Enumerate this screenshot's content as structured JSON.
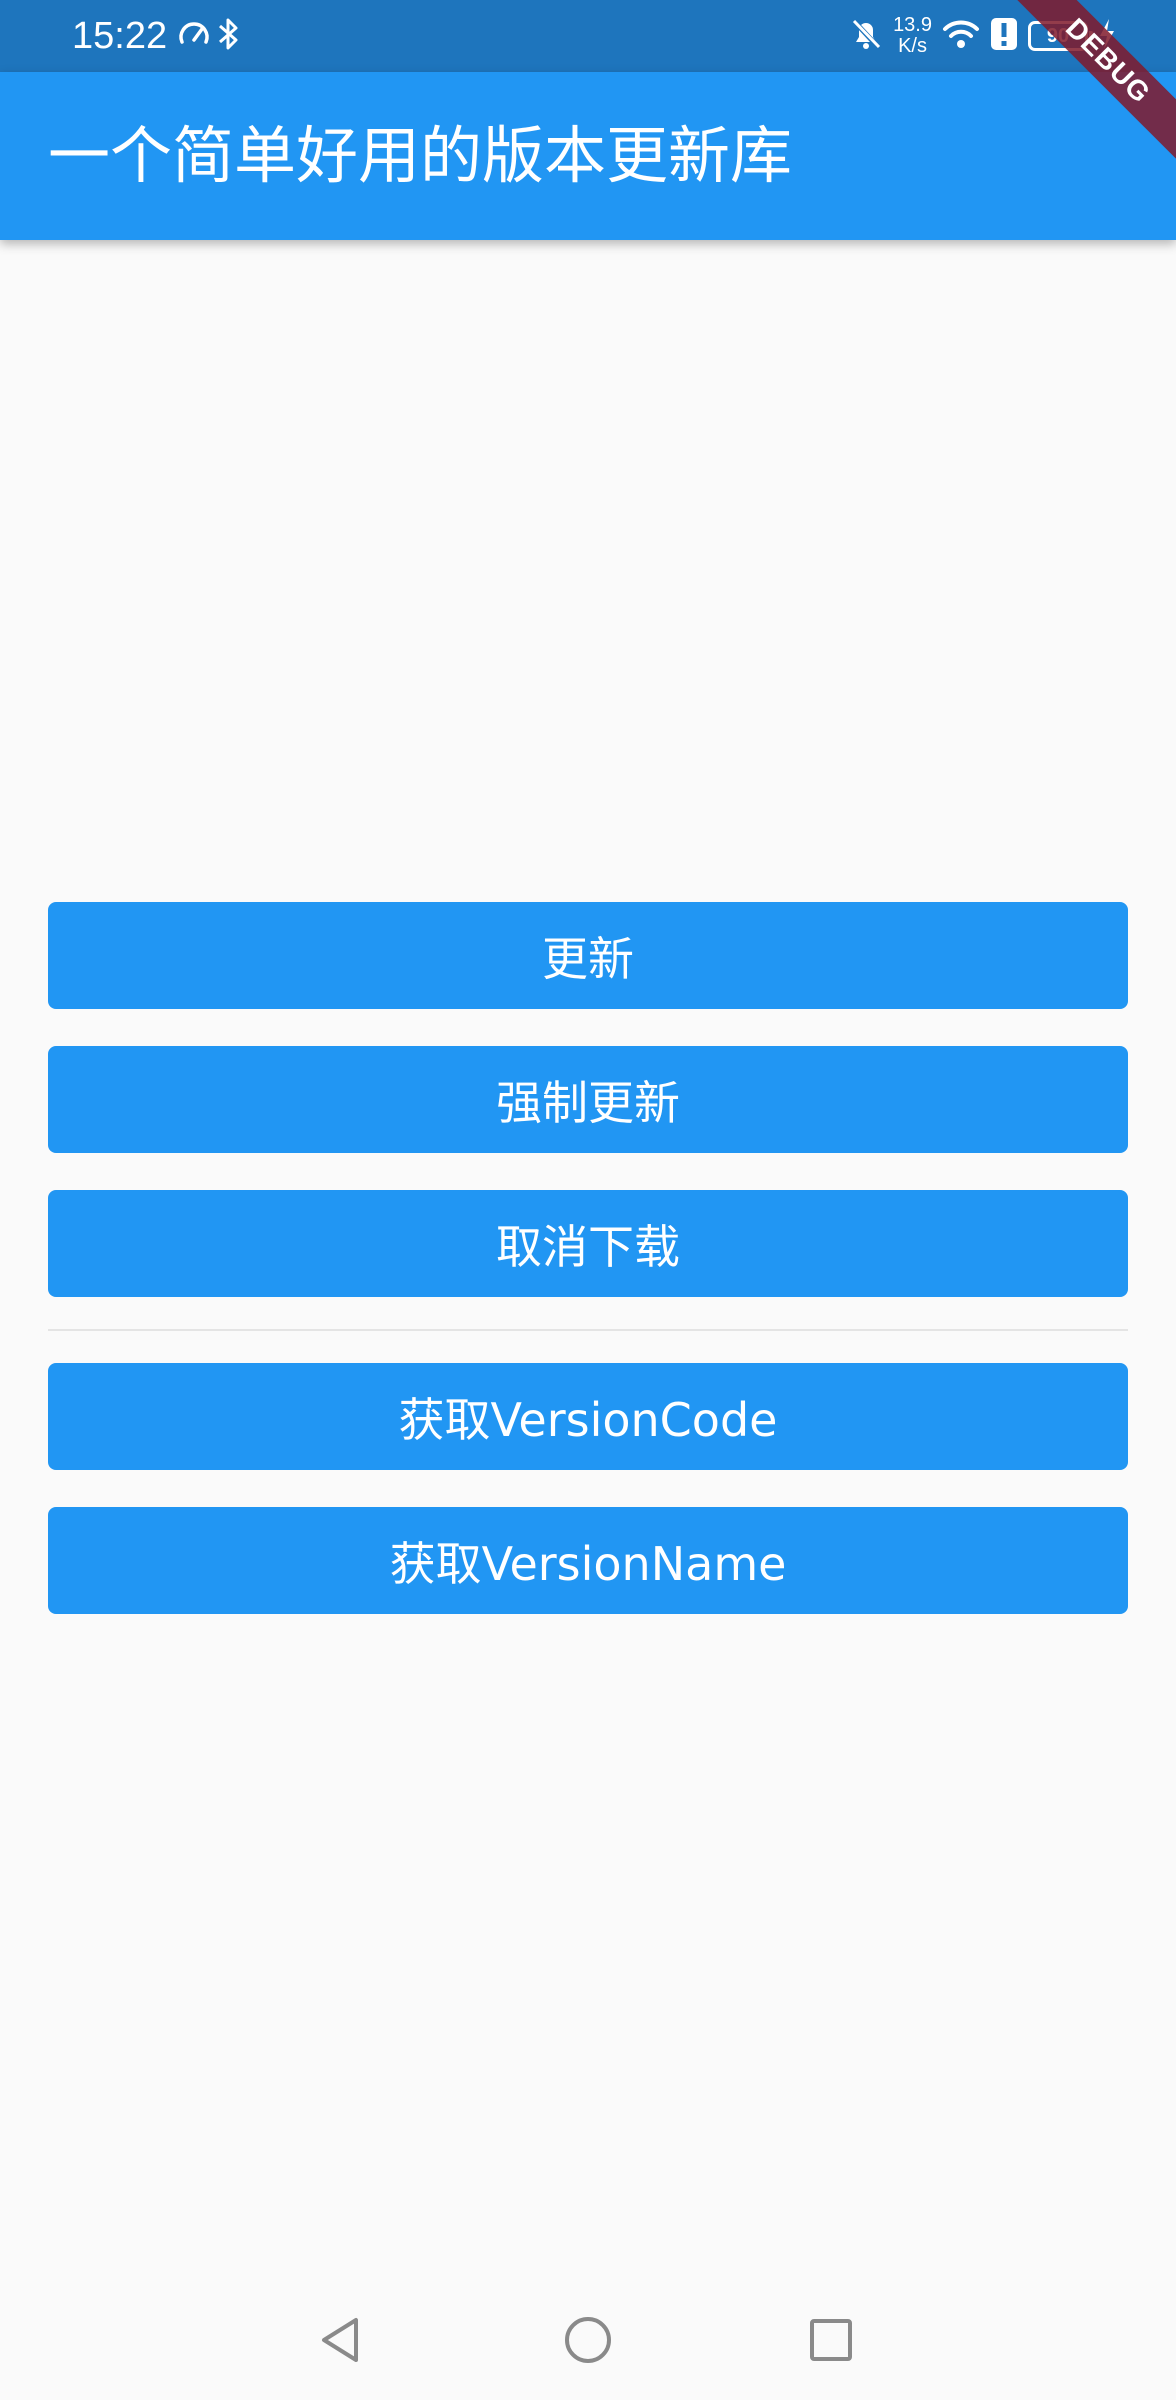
{
  "status_bar": {
    "time": "15:22",
    "net_speed_value": "13.9",
    "net_speed_unit": "K/s",
    "battery_level": "90",
    "icons": [
      "speedometer-icon",
      "bluetooth-icon",
      "bell-off-icon",
      "wifi-icon",
      "alert-icon",
      "battery-icon",
      "charging-icon"
    ]
  },
  "debug_banner": "DEBUG",
  "app_bar": {
    "title": "一个简单好用的版本更新库",
    "color": "#2196f3"
  },
  "buttons": {
    "update": "更新",
    "force_update": "强制更新",
    "cancel_download": "取消下载",
    "get_version_code": "获取VersionCode",
    "get_version_name": "获取VersionName"
  },
  "nav_bar": {
    "icons": [
      "back-icon",
      "home-icon",
      "recents-icon"
    ]
  },
  "colors": {
    "primary": "#2196f3",
    "status_bar": "#1e75bd",
    "background": "#fafafa",
    "debug_banner": "#801a2c"
  }
}
